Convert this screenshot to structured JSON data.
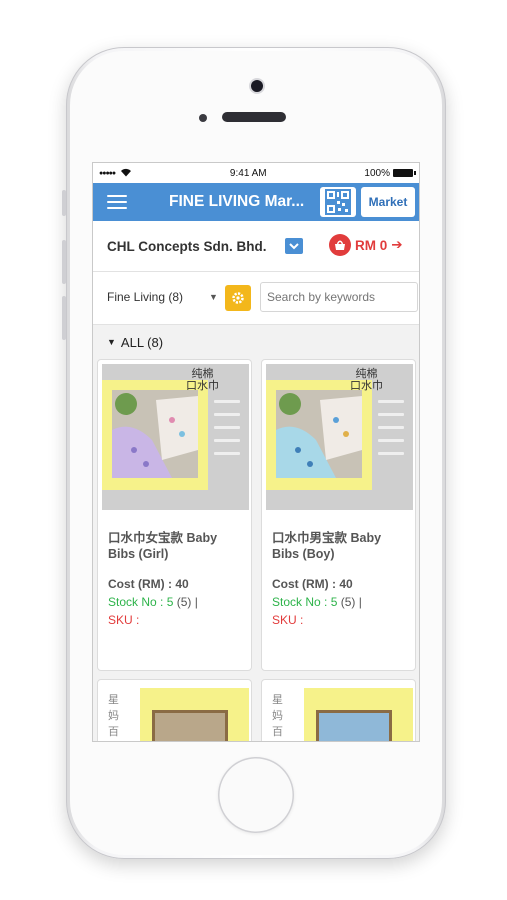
{
  "status_bar": {
    "signal": "●●●●●",
    "time": "9:41 AM",
    "battery": "100%"
  },
  "app_bar": {
    "title": "FINE LIVING Mar...",
    "market_label": "Market"
  },
  "company": {
    "name": "CHL Concepts Sdn. Bhd.",
    "cart_total": "RM 0"
  },
  "filter": {
    "category": "Fine Living (8)",
    "search_placeholder": "Search by keywords"
  },
  "section": {
    "label": "ALL (8)"
  },
  "products": [
    {
      "thumb_text": "纯棉\n口水巾",
      "name": "口水巾女宝款 Baby Bibs (Girl)",
      "cost": "Cost (RM) : 40",
      "stock_label": "Stock No : 5",
      "stock_extra": " (5) |",
      "sku": "SKU :",
      "accent": "#c9b6e6"
    },
    {
      "thumb_text": "纯棉\n口水巾",
      "name": "口水巾男宝款 Baby Bibs (Boy)",
      "cost": "Cost (RM) : 40",
      "stock_label": "Stock No : 5",
      "stock_extra": " (5) |",
      "sku": "SKU :",
      "accent": "#a8d8e8"
    }
  ],
  "next_products": [
    {
      "thumb_text": "星妈百家"
    },
    {
      "thumb_text": "星妈百家"
    }
  ],
  "colors": {
    "primary": "#4a8fd4",
    "cart_red": "#e13c3c",
    "stock_green": "#2db34a",
    "gear_yellow": "#f3b71b"
  }
}
